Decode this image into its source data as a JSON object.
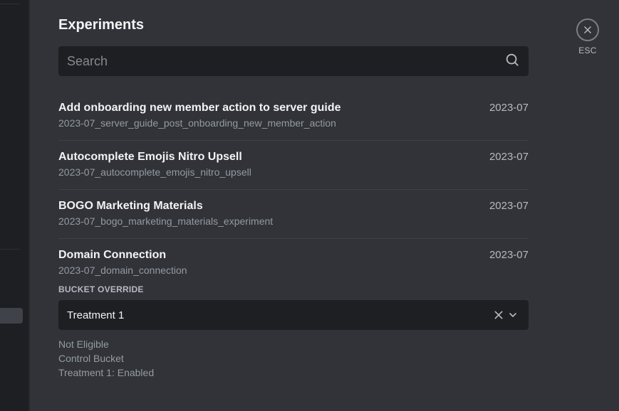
{
  "header": {
    "title": "Experiments"
  },
  "search": {
    "placeholder": "Search",
    "value": ""
  },
  "close": {
    "label": "ESC"
  },
  "experiments": [
    {
      "title": "Add onboarding new member action to server guide",
      "id": "2023-07_server_guide_post_onboarding_new_member_action",
      "date": "2023-07"
    },
    {
      "title": "Autocomplete Emojis Nitro Upsell",
      "id": "2023-07_autocomplete_emojis_nitro_upsell",
      "date": "2023-07"
    },
    {
      "title": "BOGO Marketing Materials",
      "id": "2023-07_bogo_marketing_materials_experiment",
      "date": "2023-07"
    },
    {
      "title": "Domain Connection",
      "id": "2023-07_domain_connection",
      "date": "2023-07",
      "bucket_label": "BUCKET OVERRIDE",
      "dropdown_value": "Treatment 1",
      "status": [
        "Not Eligible",
        "Control Bucket",
        "Treatment 1: Enabled"
      ]
    }
  ]
}
